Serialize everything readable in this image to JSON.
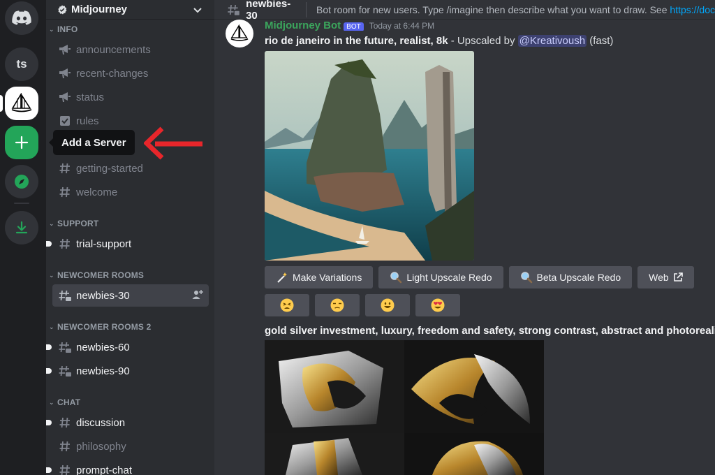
{
  "rail": {
    "user_server_initials": "ts",
    "add_server_tooltip": "Add a Server"
  },
  "guild": {
    "name": "Midjourney"
  },
  "categories": {
    "info": "INFO",
    "support": "SUPPORT",
    "newcomer_rooms": "NEWCOMER ROOMS",
    "newcomer_rooms_2": "NEWCOMER ROOMS 2",
    "chat": "CHAT"
  },
  "channels": {
    "announcements": "announcements",
    "recent_changes": "recent-changes",
    "status": "status",
    "rules": "rules",
    "getting_started": "getting-started",
    "welcome": "welcome",
    "trial_support": "trial-support",
    "newbies_30": "newbies-30",
    "newbies_60": "newbies-60",
    "newbies_90": "newbies-90",
    "discussion": "discussion",
    "philosophy": "philosophy",
    "prompt_chat": "prompt-chat"
  },
  "topbar": {
    "channel_name": "newbies-30",
    "topic": "Bot room for new users. Type /imagine then describe what you want to draw. See ",
    "topic_link": "https://doc"
  },
  "message": {
    "author": "Midjourney Bot",
    "bot_tag": "BOT",
    "timestamp": "Today at 6:44 PM",
    "prompt_bold": "rio de janeiro in the future, realist, 8k",
    "upscaled_by": " - Upscaled by ",
    "mention": "@Kreativoush",
    "speed": " (fast)",
    "buttons": {
      "make_variations": "Make Variations",
      "light_upscale_redo": "Light Upscale Redo",
      "beta_upscale_redo": "Beta Upscale Redo",
      "web": "Web"
    }
  },
  "message2": {
    "prompt": "gold silver investment, luxury, freedom and safety, strong contrast, abstract and photorealis"
  },
  "colors": {
    "accent_green": "#23a559",
    "blurple": "#5865f2",
    "annotation_red": "#e8262b"
  }
}
